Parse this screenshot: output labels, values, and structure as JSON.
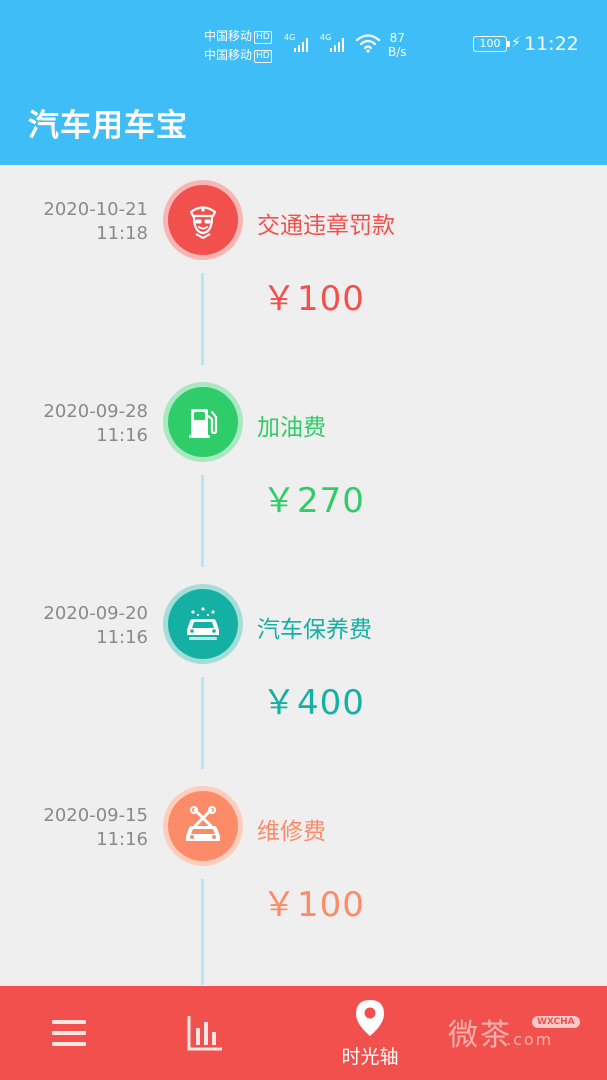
{
  "status_bar": {
    "carrier1": "中国移动",
    "carrier2": "中国移动",
    "hd": "HD",
    "net1": "4G",
    "net2": "4G",
    "speed_value": "87",
    "speed_unit": "B/s",
    "battery": "100",
    "time": "11:22"
  },
  "header": {
    "title": "汽车用车宝"
  },
  "entries": [
    {
      "date": "2020-10-21",
      "time": "11:18",
      "name": "交通违章罚款",
      "amount": "￥100",
      "color": "#f2504c",
      "halo": "#f7b6b3",
      "icon": "traffic-police-icon"
    },
    {
      "date": "2020-09-28",
      "time": "11:16",
      "name": "加油费",
      "amount": "￥270",
      "color": "#2fcc6a",
      "halo": "#a9e8c0",
      "icon": "fuel-pump-icon"
    },
    {
      "date": "2020-09-20",
      "time": "11:16",
      "name": "汽车保养费",
      "amount": "￥400",
      "color": "#14b0a4",
      "halo": "#a5ddd8",
      "icon": "car-wash-icon"
    },
    {
      "date": "2020-09-15",
      "time": "11:16",
      "name": "维修费",
      "amount": "￥100",
      "color": "#fc8b69",
      "halo": "#fdcdbe",
      "icon": "car-repair-icon"
    }
  ],
  "nav": {
    "items": [
      {
        "icon": "menu-icon"
      },
      {
        "icon": "bar-chart-icon"
      },
      {
        "icon": "location-pin-icon",
        "label": "时光轴"
      }
    ]
  },
  "watermark": {
    "text": "微茶",
    "domain": ".com",
    "badge": "WXCHA"
  }
}
